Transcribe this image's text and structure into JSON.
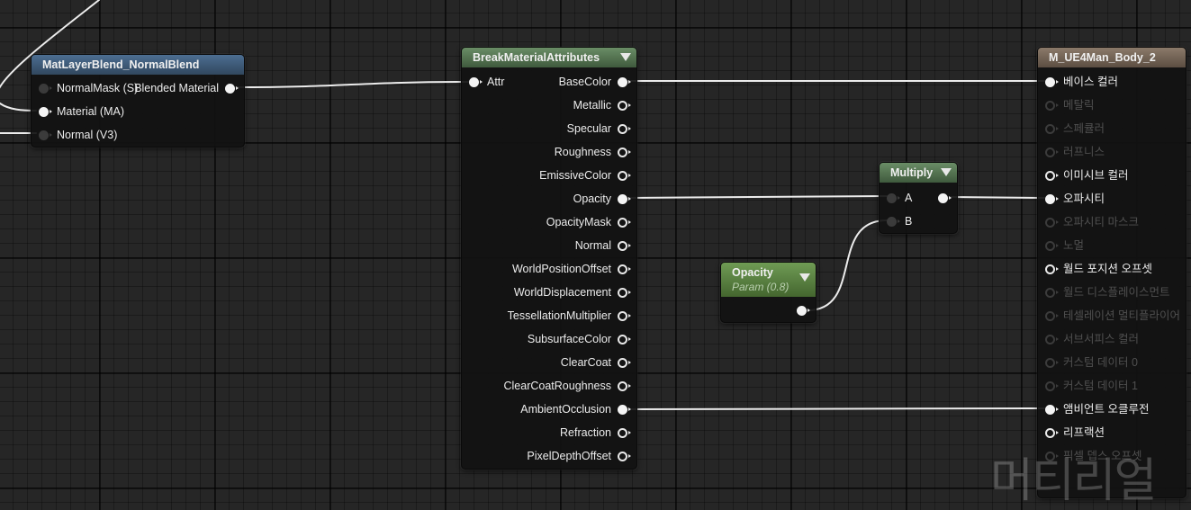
{
  "nodes": {
    "matlayer": {
      "title": "MatLayerBlend_NormalBlend",
      "header_color": "#3f5f80",
      "inputs": [
        {
          "label": "NormalMask (S)",
          "pin": "dim",
          "name": "input-normalmask-s"
        },
        {
          "label": "Material (MA)",
          "pin": "filled",
          "name": "input-material-ma"
        },
        {
          "label": "Normal (V3)",
          "pin": "dim",
          "name": "input-normal-v3"
        }
      ],
      "outputs": [
        {
          "label": "Blended Material",
          "pin": "filled",
          "name": "output-blended-material"
        }
      ]
    },
    "breakmat": {
      "title": "BreakMaterialAttributes",
      "header_color": "#5a7d56",
      "inputs": [
        {
          "label": "Attr",
          "pin": "filled",
          "name": "input-attr"
        }
      ],
      "outputs": [
        {
          "label": "BaseColor",
          "pin": "filled",
          "name": "output-basecolor"
        },
        {
          "label": "Metallic",
          "pin": "open",
          "name": "output-metallic"
        },
        {
          "label": "Specular",
          "pin": "open",
          "name": "output-specular"
        },
        {
          "label": "Roughness",
          "pin": "open",
          "name": "output-roughness"
        },
        {
          "label": "EmissiveColor",
          "pin": "open",
          "name": "output-emissivecolor"
        },
        {
          "label": "Opacity",
          "pin": "filled",
          "name": "output-opacity"
        },
        {
          "label": "OpacityMask",
          "pin": "open",
          "name": "output-opacitymask"
        },
        {
          "label": "Normal",
          "pin": "open",
          "name": "output-normal"
        },
        {
          "label": "WorldPositionOffset",
          "pin": "open",
          "name": "output-worldpositionoffset"
        },
        {
          "label": "WorldDisplacement",
          "pin": "open",
          "name": "output-worlddisplacement"
        },
        {
          "label": "TessellationMultiplier",
          "pin": "open",
          "name": "output-tessellationmultiplier"
        },
        {
          "label": "SubsurfaceColor",
          "pin": "open",
          "name": "output-subsurfacecolor"
        },
        {
          "label": "ClearCoat",
          "pin": "open",
          "name": "output-clearcoat"
        },
        {
          "label": "ClearCoatRoughness",
          "pin": "open",
          "name": "output-clearcoatroughness"
        },
        {
          "label": "AmbientOcclusion",
          "pin": "filled",
          "name": "output-ambientocclusion"
        },
        {
          "label": "Refraction",
          "pin": "open",
          "name": "output-refraction"
        },
        {
          "label": "PixelDepthOffset",
          "pin": "open",
          "name": "output-pixeldepthoffset"
        }
      ]
    },
    "multiply": {
      "title": "Multiply",
      "header_color": "#5a7d56",
      "inputs": [
        {
          "label": "A",
          "pin": "dim",
          "name": "input-a"
        },
        {
          "label": "B",
          "pin": "dim",
          "name": "input-b"
        }
      ],
      "outputs": [
        {
          "label": "",
          "pin": "filled",
          "name": "output-result"
        }
      ]
    },
    "opacity": {
      "title": "Opacity",
      "subtitle": "Param (0.8)",
      "header_color": "#5d8a44",
      "outputs": [
        {
          "label": "",
          "pin": "filled",
          "name": "output-value"
        }
      ]
    },
    "result": {
      "title": "M_UE4Man_Body_2",
      "header_color": "#7a6a5c",
      "inputs": [
        {
          "label": "베이스 컬러",
          "pin": "filled",
          "name": "input-base-color"
        },
        {
          "label": "메탈릭",
          "pin": "dimopen",
          "name": "input-metallic"
        },
        {
          "label": "스페큘러",
          "pin": "dimopen",
          "name": "input-specular"
        },
        {
          "label": "러프니스",
          "pin": "dimopen",
          "name": "input-roughness"
        },
        {
          "label": "이미시브 컬러",
          "pin": "open",
          "name": "input-emissive-color"
        },
        {
          "label": "오파시티",
          "pin": "filled",
          "name": "input-opacity"
        },
        {
          "label": "오파시티 마스크",
          "pin": "dimopen",
          "name": "input-opacity-mask"
        },
        {
          "label": "노멀",
          "pin": "dimopen",
          "name": "input-normal"
        },
        {
          "label": "월드 포지션 오프셋",
          "pin": "open",
          "name": "input-world-position-offset"
        },
        {
          "label": "월드 디스플레이스먼트",
          "pin": "dimopen",
          "name": "input-world-displacement"
        },
        {
          "label": "테셀레이션 멀티플라이어",
          "pin": "dimopen",
          "name": "input-tessellation-multiplier"
        },
        {
          "label": "서브서피스 컬러",
          "pin": "dimopen",
          "name": "input-subsurface-color"
        },
        {
          "label": "커스텀 데이터 0",
          "pin": "dimopen",
          "name": "input-custom-data-0"
        },
        {
          "label": "커스텀 데이터 1",
          "pin": "dimopen",
          "name": "input-custom-data-1"
        },
        {
          "label": "앰비언트 오클루전",
          "pin": "filled",
          "name": "input-ambient-occlusion"
        },
        {
          "label": "리프랙션",
          "pin": "open",
          "name": "input-refraction"
        },
        {
          "label": "픽셀 뎁스 오프셋",
          "pin": "dimopen",
          "name": "input-pixel-depth-offset"
        }
      ]
    }
  },
  "watermark": "머티리얼"
}
